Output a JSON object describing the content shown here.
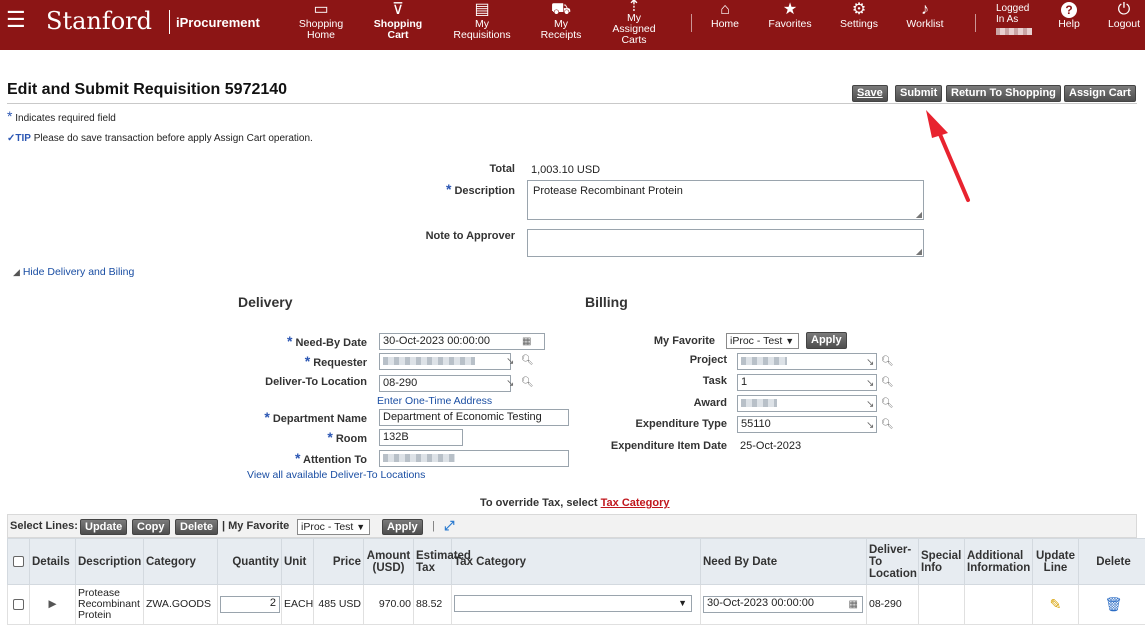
{
  "topbar": {
    "brand": "Stanford",
    "app_name": "iProcurement",
    "nav": [
      {
        "name": "shopping-home",
        "icon": "store-icon",
        "glyph": "▭",
        "label": "Shopping\nHome"
      },
      {
        "name": "shopping-cart",
        "icon": "cart-icon",
        "glyph": "⛟",
        "label": "Shopping\nCart"
      },
      {
        "name": "my-requisitions",
        "icon": "document-icon",
        "glyph": "▤",
        "label": "My\nRequisitions"
      },
      {
        "name": "my-receipts",
        "icon": "truck-icon",
        "glyph": "⛟",
        "label": "My\nReceipts"
      },
      {
        "name": "my-assigned-carts",
        "icon": "assign-icon",
        "glyph": "⇡",
        "label": "My\nAssigned\nCarts"
      },
      {
        "name": "home",
        "icon": "home-icon",
        "glyph": "⌂",
        "label": "Home"
      },
      {
        "name": "favorites",
        "icon": "star-icon",
        "glyph": "★",
        "label": "Favorites"
      },
      {
        "name": "settings",
        "icon": "gear-icon",
        "glyph": "⚙",
        "label": "Settings"
      },
      {
        "name": "worklist",
        "icon": "bell-icon",
        "glyph": "🔔",
        "label": "Worklist"
      },
      {
        "name": "help",
        "icon": "help-icon",
        "glyph": "?",
        "label": "Help"
      },
      {
        "name": "logout",
        "icon": "power-icon",
        "glyph": "⏻",
        "label": "Logout"
      }
    ],
    "logged_in_as": "Logged\nIn As"
  },
  "page": {
    "title": "Edit and Submit Requisition 5972140",
    "required_note": "Indicates required field",
    "tip_label": "TIP",
    "tip_text": "Please do save transaction before apply Assign Cart operation.",
    "buttons": {
      "save": "Save",
      "submit": "Submit",
      "return": "Return To Shopping",
      "assign": "Assign Cart"
    }
  },
  "summary": {
    "total_label": "Total",
    "total_value": "1,003.10 USD",
    "description_label": "Description",
    "description_value": "Protease Recombinant Protein",
    "note_label": "Note to Approver",
    "note_value": ""
  },
  "toggle_label": "Hide Delivery and Biling",
  "delivery": {
    "heading": "Delivery",
    "need_by_label": "Need-By Date",
    "need_by_value": "30-Oct-2023 00:00:00",
    "requester_label": "Requester",
    "deliver_to_label": "Deliver-To Location",
    "deliver_to_value": "08-290",
    "one_time_link": "Enter One-Time Address",
    "department_label": "Department Name",
    "department_value": "Department of Economic Testing",
    "room_label": "Room",
    "room_value": "132B",
    "attention_label": "Attention To",
    "view_all_link": "View all available Deliver-To Locations"
  },
  "billing": {
    "heading": "Billing",
    "favorite_label": "My Favorite",
    "favorite_value": "iProc - Test",
    "apply": "Apply",
    "project_label": "Project",
    "task_label": "Task",
    "task_value": "1",
    "award_label": "Award",
    "expenditure_type_label": "Expenditure Type",
    "expenditure_type_value": "55110",
    "expenditure_date_label": "Expenditure Item Date",
    "expenditure_date_value": "25-Oct-2023"
  },
  "tax_note": {
    "text": "To override Tax, select ",
    "link": "Tax Category"
  },
  "lines_toolbar": {
    "select_lines": "Select Lines:",
    "update": "Update",
    "copy": "Copy",
    "delete": "Delete",
    "favorite_label": "| My Favorite",
    "favorite_value": "iProc - Test",
    "apply": "Apply"
  },
  "lines": {
    "headers": {
      "details": "Details",
      "description": "Description",
      "category": "Category",
      "quantity": "Quantity",
      "unit": "Unit",
      "price": "Price",
      "amount": "Amount (USD)",
      "est_tax": "Estimated Tax",
      "tax_category": "Tax Category",
      "need_by": "Need By Date",
      "deliver_to": "Deliver-To Location",
      "special": "Special Info",
      "additional": "Additional Information",
      "update_line": "Update Line",
      "delete": "Delete"
    },
    "rows": [
      {
        "description": "Protease Recombinant Protein",
        "category": "ZWA.GOODS",
        "quantity": "2",
        "unit": "EACH",
        "price": "485 USD",
        "amount": "970.00",
        "est_tax": "88.52",
        "tax_category": "",
        "need_by": "30-Oct-2023 00:00:00",
        "deliver_to": "08-290"
      }
    ]
  },
  "colors": {
    "brand": "#8c1515",
    "link": "#1a4ea3",
    "arrow": "#e8232f",
    "tax_link": "#c0161c"
  }
}
